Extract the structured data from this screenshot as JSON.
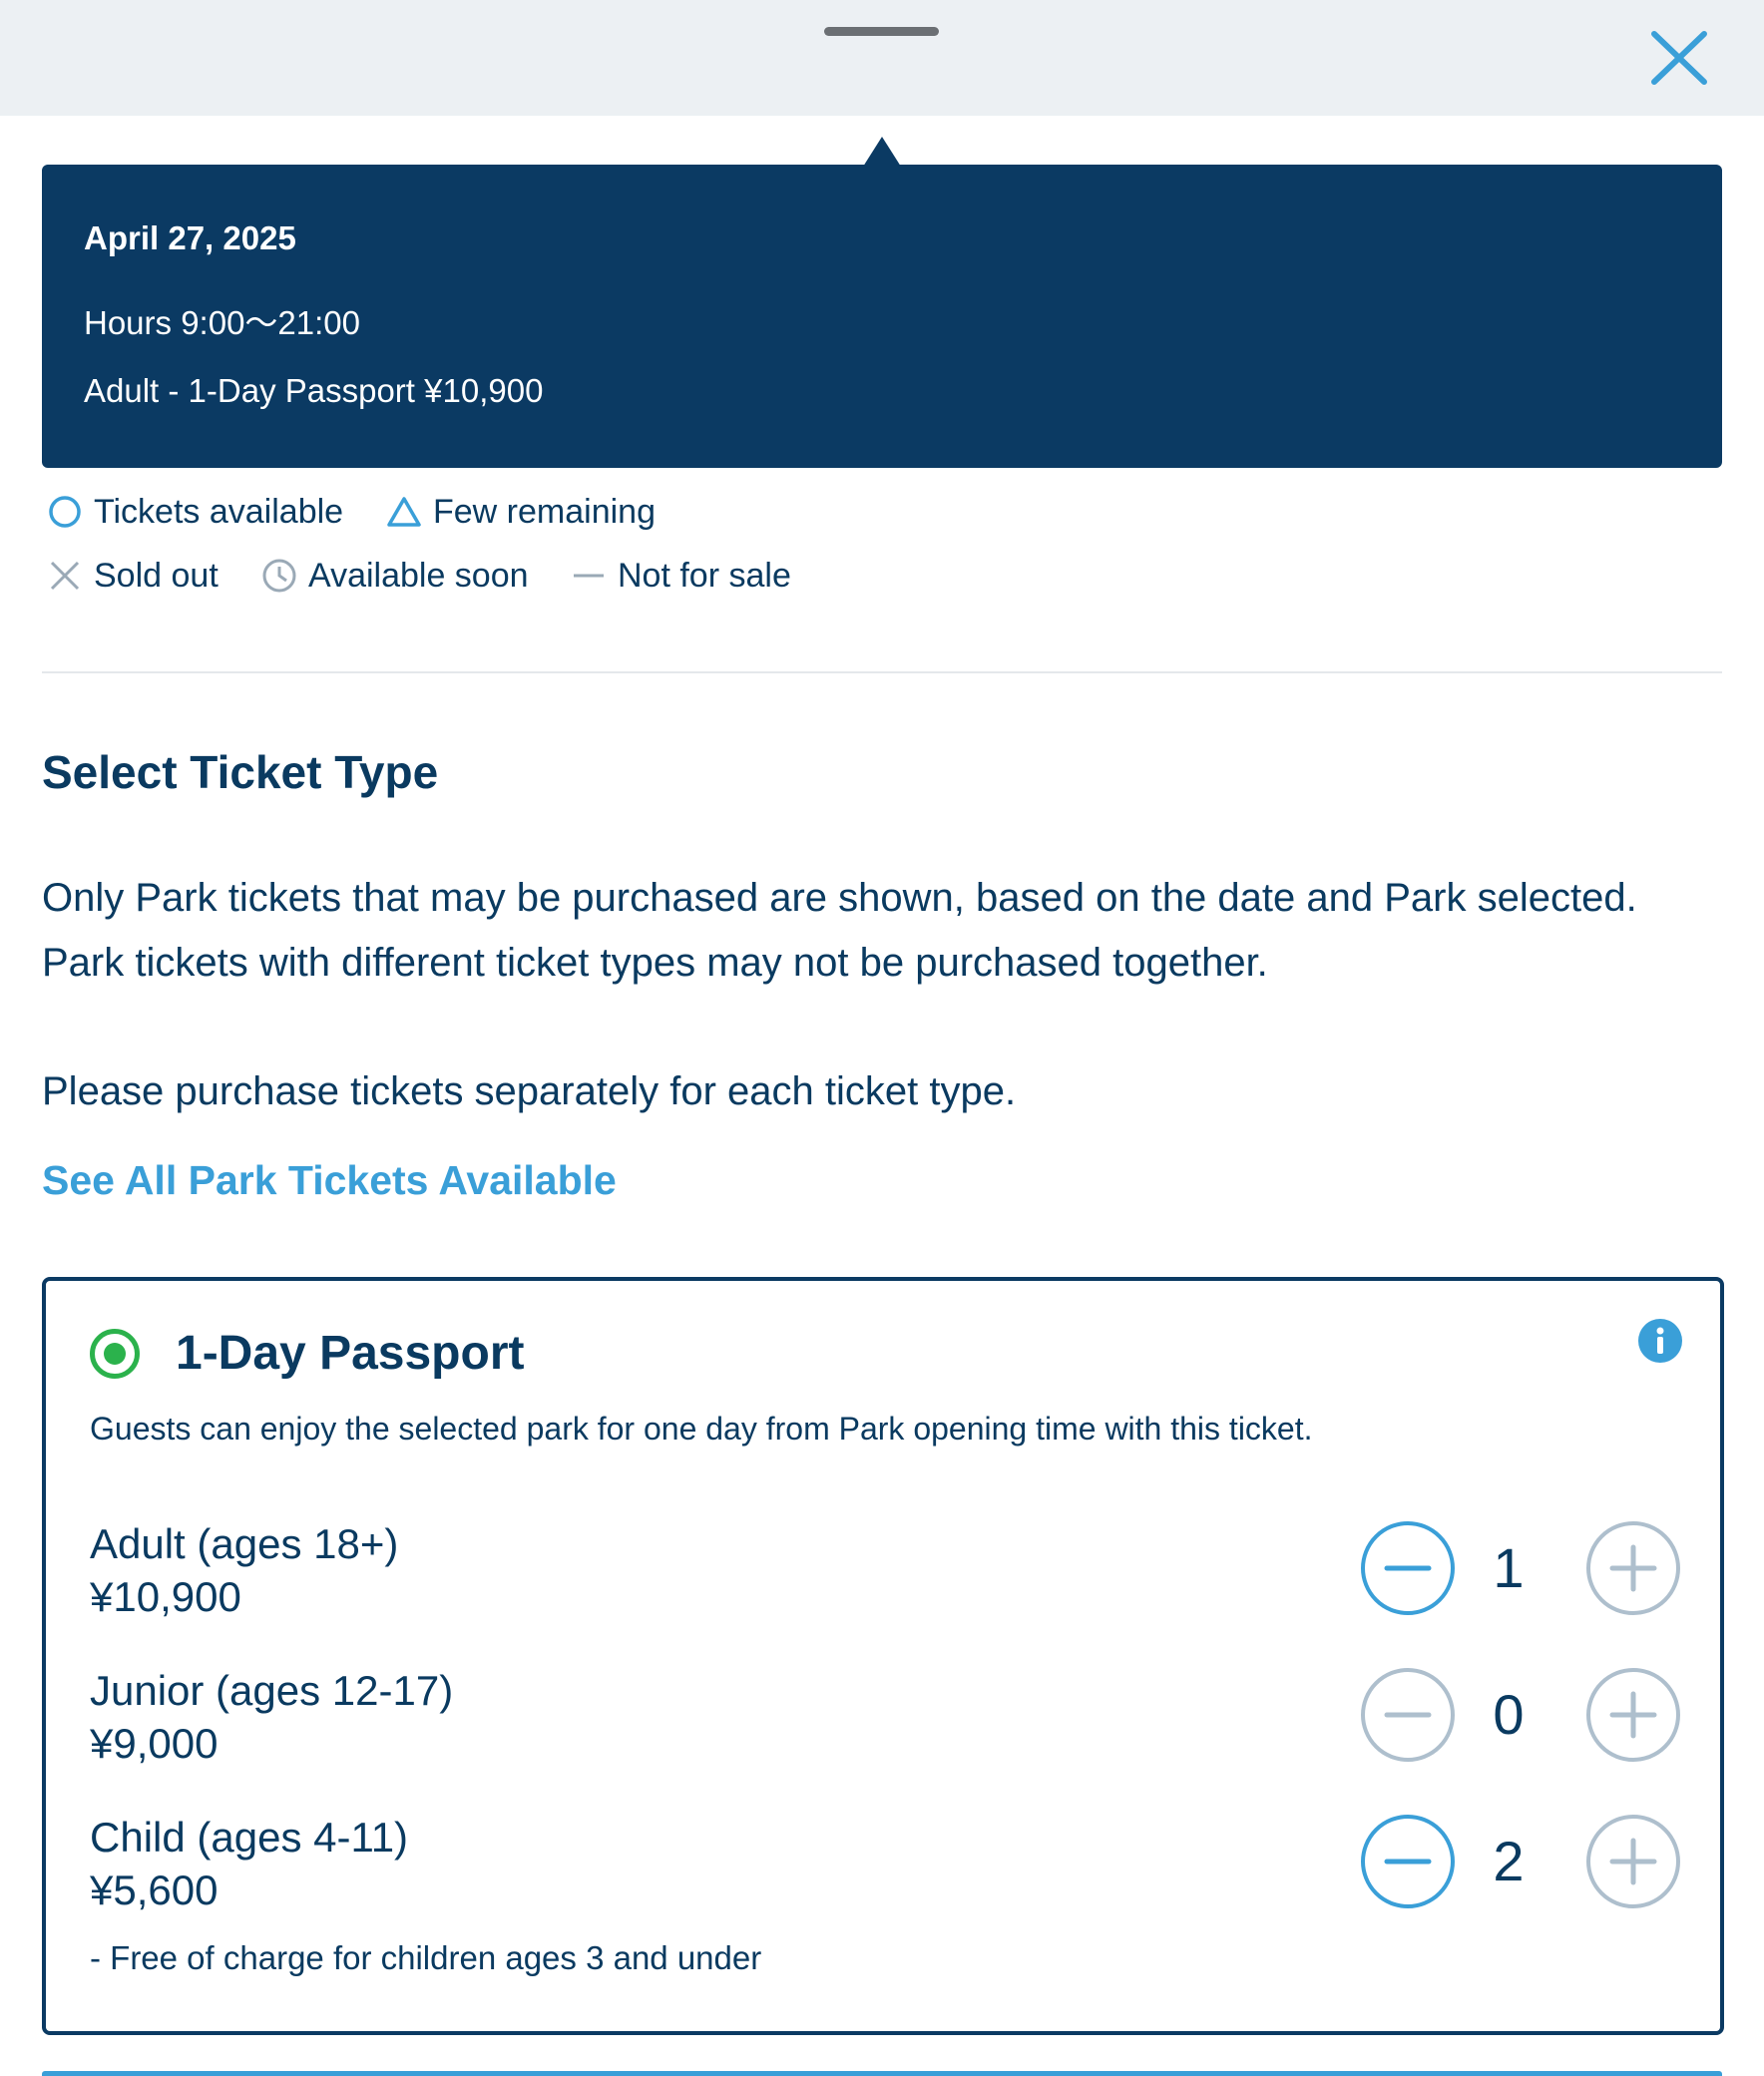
{
  "header": {
    "handle_icon": "drag-handle",
    "close_icon": "close-icon"
  },
  "date_info": {
    "date": "April 27, 2025",
    "hours": "Hours 9:00〜21:00",
    "price": "Adult - 1-Day Passport ¥10,900"
  },
  "legend": {
    "available": "Tickets available",
    "few": "Few remaining",
    "sold_out": "Sold out",
    "soon": "Available soon",
    "not_for_sale": "Not for sale"
  },
  "section": {
    "title": "Select Ticket Type",
    "paragraph_line1": "Only Park tickets that may be purchased are shown, based on the date and Park selected.",
    "paragraph_line2": "Park tickets with different ticket types may not be purchased together.",
    "paragraph_line3": "Please purchase tickets separately for each ticket type.",
    "link_text": "See All Park Tickets Available"
  },
  "ticket_card": {
    "title": "1-Day Passport",
    "description": "Guests can enjoy the selected park for one day from Park opening time with this ticket.",
    "selected": true,
    "rows": [
      {
        "label": "Adult (ages 18+)",
        "price": "¥10,900",
        "quantity": "1"
      },
      {
        "label": "Junior (ages 12-17)",
        "price": "¥9,000",
        "quantity": "0"
      },
      {
        "label": "Child (ages 4-11)",
        "price": "¥5,600",
        "quantity": "2"
      }
    ],
    "note": "- Free of charge for children ages 3 and under"
  },
  "colors": {
    "navy": "#0b3a63",
    "accent_blue": "#3a9fd8",
    "selected_green": "#2bb24c",
    "disabled_gray": "#aebfcd"
  }
}
